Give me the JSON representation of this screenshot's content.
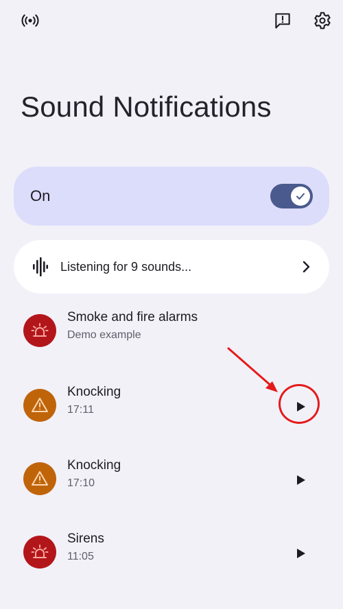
{
  "topbar": {
    "left_icon": "broadcast-icon",
    "feedback_icon": "feedback-icon",
    "settings_icon": "gear-icon"
  },
  "title": "Sound Notifications",
  "toggle_card": {
    "label": "On",
    "state": "on",
    "accent_color": "#4a5a8e",
    "card_color": "#dcdcfb"
  },
  "listening": {
    "text": "Listening for 9 sounds...",
    "icon": "waveform-icon",
    "chevron": "chevron-right-icon"
  },
  "sounds": [
    {
      "name": "Smoke and fire alarms",
      "subtitle": "Demo example",
      "icon": "siren-icon",
      "icon_color": "#b3161a",
      "has_play": false
    },
    {
      "name": "Knocking",
      "subtitle": "17:11",
      "icon": "warning-icon",
      "icon_color": "#c0640a",
      "has_play": true
    },
    {
      "name": "Knocking",
      "subtitle": "17:10",
      "icon": "warning-icon",
      "icon_color": "#c0640a",
      "has_play": true
    },
    {
      "name": "Sirens",
      "subtitle": "11:05",
      "icon": "siren-icon",
      "icon_color": "#b3161a",
      "has_play": true
    }
  ],
  "annotation": {
    "color": "#e51a1a",
    "target": "play-button knocking 17:11"
  }
}
